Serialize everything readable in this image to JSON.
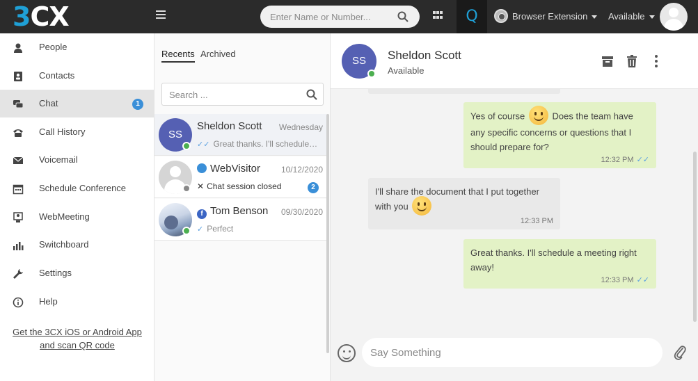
{
  "header": {
    "logo_3": "3",
    "logo_cx": "CX",
    "search_placeholder": "Enter Name or Number...",
    "q_label": "Q",
    "extension_label": "Browser Extension",
    "status_label": "Available"
  },
  "sidebar": {
    "items": [
      {
        "label": "People",
        "icon": "person-icon"
      },
      {
        "label": "Contacts",
        "icon": "contacts-icon"
      },
      {
        "label": "Chat",
        "icon": "chat-icon",
        "badge": "1",
        "active": true
      },
      {
        "label": "Call History",
        "icon": "phone-icon"
      },
      {
        "label": "Voicemail",
        "icon": "voicemail-icon"
      },
      {
        "label": "Schedule Conference",
        "icon": "calendar-icon"
      },
      {
        "label": "WebMeeting",
        "icon": "webmeeting-icon"
      },
      {
        "label": "Switchboard",
        "icon": "bar-chart-icon"
      },
      {
        "label": "Settings",
        "icon": "wrench-icon"
      },
      {
        "label": "Help",
        "icon": "info-icon"
      }
    ],
    "app_link": "Get the 3CX iOS or Android App and scan QR code"
  },
  "conversations": {
    "tabs": [
      "Recents",
      "Archived"
    ],
    "search_placeholder": "Search ...",
    "items": [
      {
        "initials": "SS",
        "name": "Sheldon Scott",
        "date": "Wednesday",
        "preview": "Great thanks. I'll schedule a meeting right away!",
        "status": "online"
      },
      {
        "name": "WebVisitor",
        "date": "10/12/2020",
        "preview": "Chat session closed",
        "badge": "2",
        "status": "offline",
        "source": "web-chat-icon"
      },
      {
        "name": "Tom Benson",
        "date": "09/30/2020",
        "preview": "Perfect",
        "status": "online",
        "source": "facebook-icon",
        "source_letter": "f"
      }
    ]
  },
  "chat": {
    "contact_initials": "SS",
    "contact_name": "Sheldon Scott",
    "contact_status": "Available",
    "messages": [
      {
        "dir": "out",
        "text_a": "Yes of course",
        "text_b": "Does the team have any specific concerns or questions that I should prepare for?",
        "time": "12:32 PM"
      },
      {
        "dir": "in",
        "text_a": "I'll share the document that I put together with you",
        "time": "12:33 PM"
      },
      {
        "dir": "out",
        "text_a": "Great thanks. I'll schedule a meeting right away!",
        "time": "12:33 PM"
      }
    ],
    "composer_placeholder": "Say Something"
  },
  "colors": {
    "accent": "#1fa0d6",
    "badge": "#3a8fd8",
    "avatar": "#5560b3",
    "outgoing_bubble": "#e3f2c6",
    "incoming_bubble": "#e9e9e9",
    "online": "#4caf50"
  }
}
